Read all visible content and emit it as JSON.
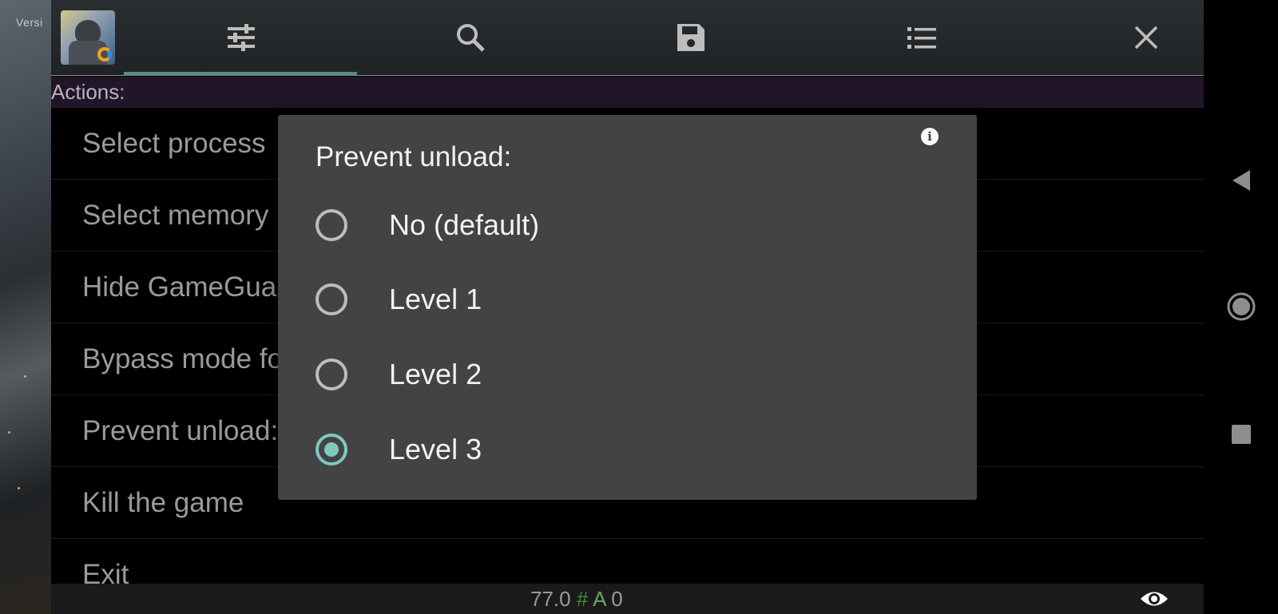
{
  "background": {
    "watermark": "Versi"
  },
  "toolbar": {
    "tabs": [
      {
        "icon": "sliders-icon"
      },
      {
        "icon": "search-icon"
      },
      {
        "icon": "save-icon"
      },
      {
        "icon": "list-icon"
      },
      {
        "icon": "close-icon"
      }
    ]
  },
  "actions_header": "Actions:",
  "menu": {
    "items": [
      {
        "label": "Select process"
      },
      {
        "label": "Select memory"
      },
      {
        "label": "Hide GameGuar"
      },
      {
        "label": "Bypass mode fo"
      },
      {
        "label": "Prevent unload:"
      },
      {
        "label": "Kill the game"
      },
      {
        "label": "Exit"
      }
    ]
  },
  "footer": {
    "value": "77.0",
    "hash": "#",
    "a": "A",
    "count": "0"
  },
  "dialog": {
    "title": "Prevent unload:",
    "info": "i",
    "options": [
      {
        "label": "No (default)",
        "selected": false
      },
      {
        "label": "Level 1",
        "selected": false
      },
      {
        "label": "Level 2",
        "selected": false
      },
      {
        "label": "Level 3",
        "selected": true
      }
    ]
  },
  "colors": {
    "accent": "#7fc8c0",
    "dialog_bg": "#434343",
    "actions_bar_bg": "#211629"
  }
}
